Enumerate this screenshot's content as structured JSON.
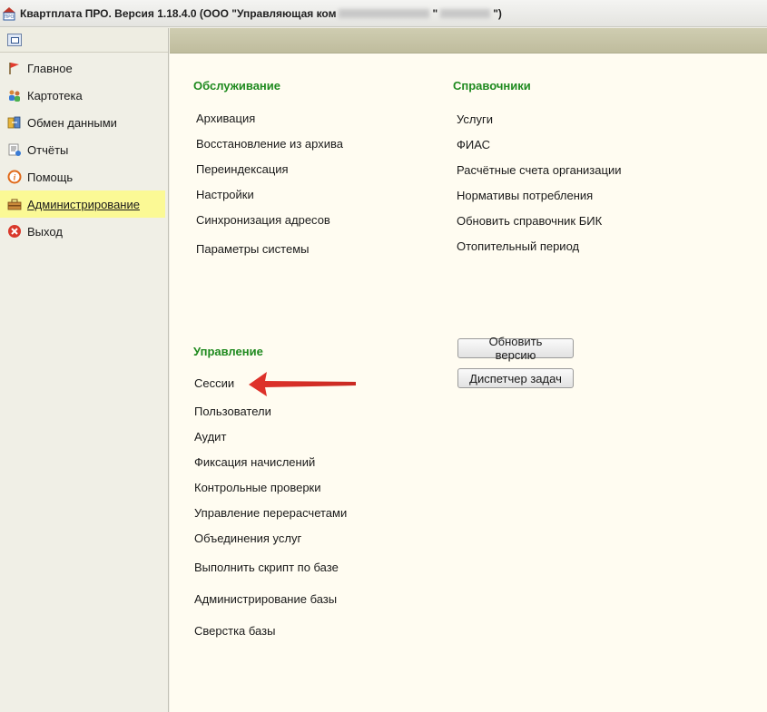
{
  "window": {
    "title_part1": "Квартплата ПРО.  Версия 1.18.4.0 (ООО \"Управляющая ком",
    "title_part2": "\"",
    "title_part3": "\")"
  },
  "sidebar": {
    "items": [
      {
        "label": "Главное"
      },
      {
        "label": "Картотека"
      },
      {
        "label": "Обмен данными"
      },
      {
        "label": "Отчёты"
      },
      {
        "label": "Помощь"
      },
      {
        "label": "Администрирование"
      },
      {
        "label": "Выход"
      }
    ]
  },
  "main": {
    "service": {
      "title": "Обслуживание",
      "items": [
        "Архивация",
        "Восстановление из архива",
        "Переиндексация",
        "Настройки",
        "Синхронизация адресов",
        "Параметры системы"
      ]
    },
    "references": {
      "title": "Справочники",
      "items": [
        "Услуги",
        "ФИАС",
        "Расчётные счета организации",
        "Нормативы потребления",
        "Обновить справочник БИК",
        "Отопительный период"
      ]
    },
    "management": {
      "title": "Управление",
      "items": [
        "Сессии",
        "Пользователи",
        "Аудит",
        "Фиксация начислений",
        "Контрольные проверки",
        "Управление перерасчетами",
        "Объединения услуг",
        "Выполнить скрипт по базе",
        "Администрирование базы",
        "Сверстка базы"
      ]
    },
    "buttons": {
      "update_version": "Обновить версию",
      "task_manager": "Диспетчер задач"
    }
  },
  "colors": {
    "section_title": "#1f8a1f",
    "active_item_bg": "#fbf995",
    "arrow": "#e0322b"
  }
}
